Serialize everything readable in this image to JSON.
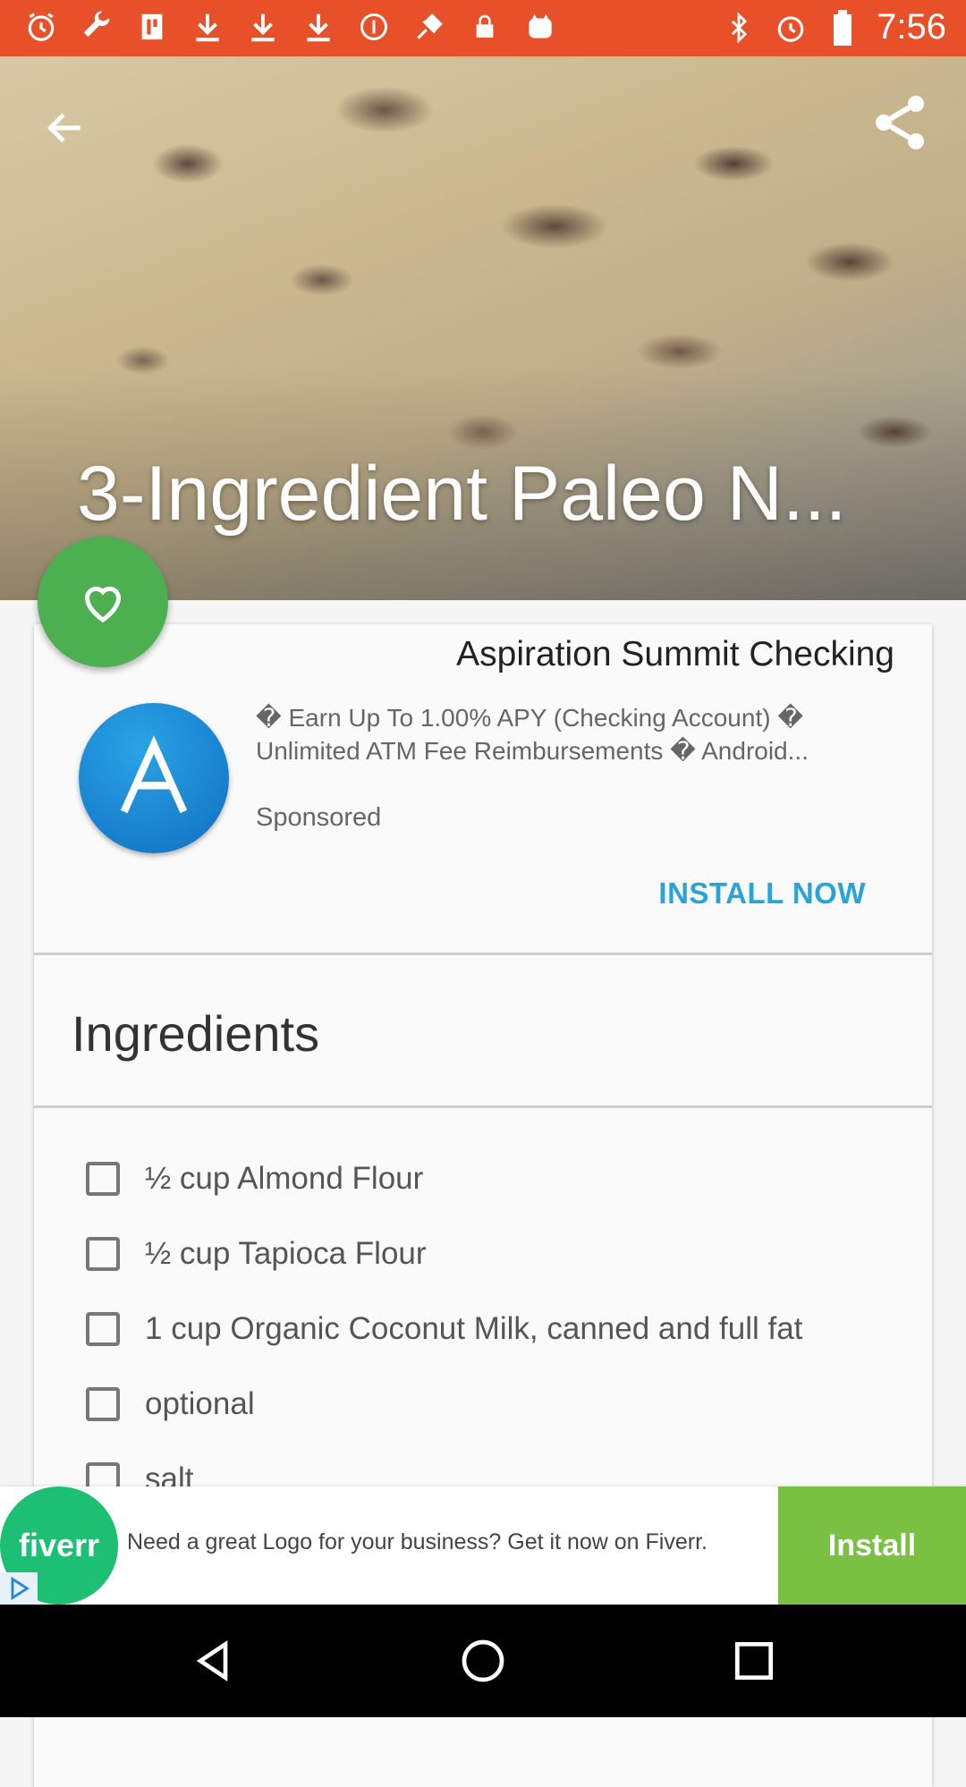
{
  "status_bar": {
    "time": "7:56",
    "left_icons": [
      "alarm-icon",
      "wrench-icon",
      "fork-icon",
      "download-icon",
      "download-icon",
      "download-icon",
      "info-circle-icon",
      "satellite-icon",
      "lock-icon",
      "cat-icon"
    ],
    "right_icons": [
      "bluetooth-icon",
      "alarm-icon",
      "battery-icon"
    ],
    "background": "#e8502a"
  },
  "hero": {
    "title": "3-Ingredient Paleo N...",
    "back_icon": "back-arrow-icon",
    "share_icon": "share-icon"
  },
  "favorite": {
    "icon": "heart-icon",
    "color": "#4caf50"
  },
  "ad": {
    "title": "Aspiration Summit Checking",
    "description": "� Earn Up To 1.00% APY (Checking Account)  � Unlimited ATM Fee Reimbursements  � Android...",
    "sponsored": "Sponsored",
    "install_label": "INSTALL NOW",
    "accent": "#29a3d8"
  },
  "ingredients": {
    "heading": "Ingredients",
    "items": [
      "½ cup Almond Flour",
      "½ cup Tapioca Flour",
      "1 cup Organic Coconut Milk, canned and full fat",
      " optional",
      " salt"
    ]
  },
  "banner": {
    "logo_text": "fiverr",
    "text": "Need a great Logo for your business? Get it now on Fiverr.",
    "install_label": "Install",
    "logo_color": "#1dbf73",
    "install_color": "#7ac143"
  },
  "nav": {
    "buttons": [
      "back-triangle-icon",
      "home-circle-icon",
      "recents-square-icon"
    ]
  }
}
